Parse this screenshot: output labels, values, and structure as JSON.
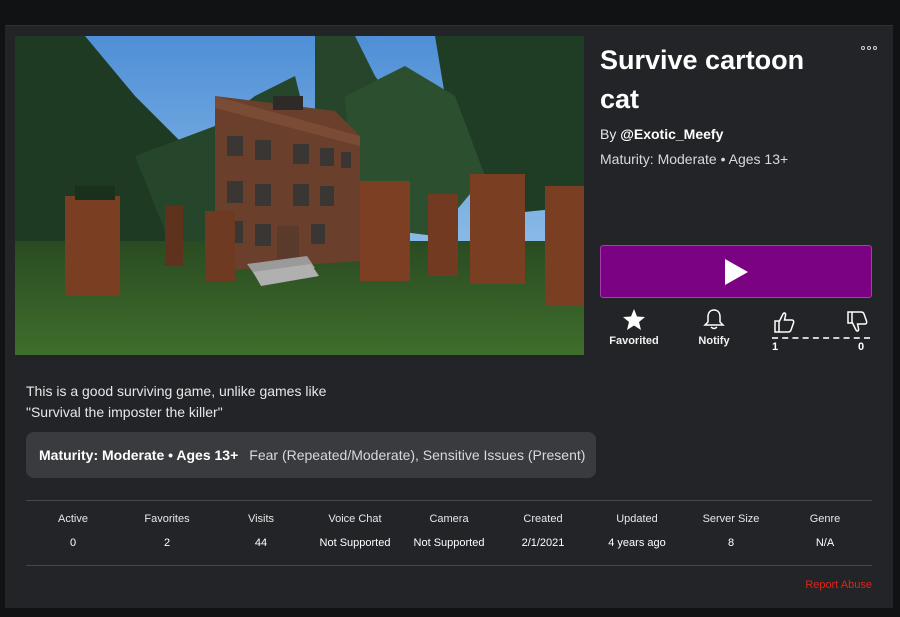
{
  "game": {
    "title": "Survive cartoon cat",
    "by_prefix": "By ",
    "creator": "@Exotic_Meefy",
    "maturity_line": "Maturity: Moderate • Ages 13+"
  },
  "actions": {
    "favorite_label": "Favorited",
    "notify_label": "Notify",
    "upvotes": "1",
    "downvotes": "0"
  },
  "description": {
    "line1": "This is a good surviving game, unlike games like",
    "line2": "\"Survival the imposter the killer\""
  },
  "maturity_badge": {
    "rating": "Maturity: Moderate • Ages 13+",
    "descriptors": "Fear (Repeated/Moderate), Sensitive Issues (Present)"
  },
  "stats": [
    {
      "label": "Active",
      "value": "0"
    },
    {
      "label": "Favorites",
      "value": "2"
    },
    {
      "label": "Visits",
      "value": "44"
    },
    {
      "label": "Voice Chat",
      "value": "Not Supported"
    },
    {
      "label": "Camera",
      "value": "Not Supported"
    },
    {
      "label": "Created",
      "value": "2/1/2021"
    },
    {
      "label": "Updated",
      "value": "4 years ago"
    },
    {
      "label": "Server Size",
      "value": "8"
    },
    {
      "label": "Genre",
      "value": "N/A"
    }
  ],
  "footer": {
    "report_label": "Report Abuse"
  },
  "icons": {
    "play": "play-icon",
    "favorite": "star-icon",
    "notify": "bell-icon",
    "upvote": "thumbs-up-icon",
    "downvote": "thumbs-down-icon",
    "more": "more-dots-icon"
  },
  "colors": {
    "play_button": "#7b0383",
    "report": "#e2231a",
    "background": "#232427"
  }
}
